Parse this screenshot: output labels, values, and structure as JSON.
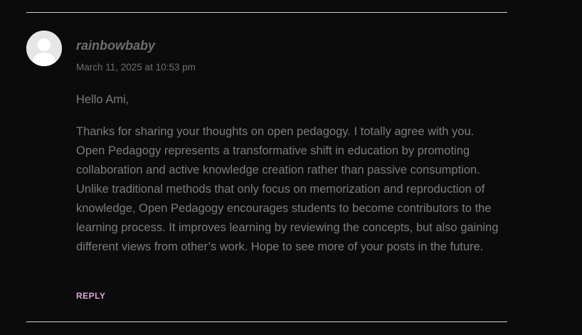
{
  "comment": {
    "author": "rainbowbaby",
    "date": "March 11, 2025 at 10:53 pm",
    "greeting": "Hello Ami,",
    "paragraph": "Thanks for sharing your thoughts on open pedagogy. I totally agree with you. Open Pedagogy represents a transformative shift in education by promoting collaboration and active knowledge creation rather than passive consumption. Unlike traditional methods that only focus on memorization and reproduction of knowledge, Open Pedagogy encourages students to become contributors to the learning process. It improves learning by reviewing the concepts, but also gaining different views from other’s work. Hope to see more of your posts in the future.",
    "reply_label": "REPLY",
    "avatar_icon": "default-user-avatar-icon"
  },
  "colors": {
    "background": "#0b0b0b",
    "text": "#7b7b7b",
    "reply_accent": "#d9a7d9",
    "divider": "#d0d0d0"
  }
}
